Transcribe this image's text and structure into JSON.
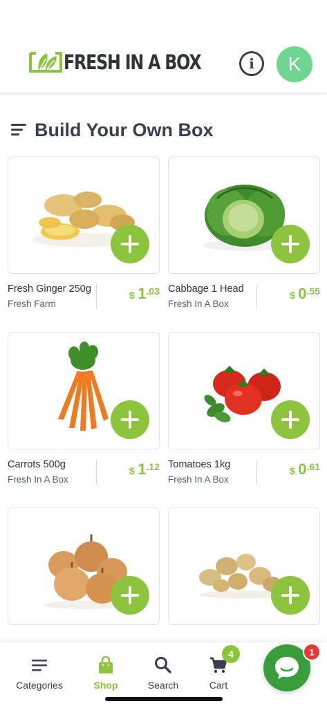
{
  "brand": {
    "name": "FRESH IN A BOX",
    "accent": "#8cc43d"
  },
  "header": {
    "avatar_initial": "K",
    "info_label": "i"
  },
  "page": {
    "title": "Build Your Own Box"
  },
  "products": [
    {
      "name": "Fresh Ginger 250g",
      "vendor": "Fresh Farm",
      "currency": "$",
      "price_whole": "1",
      "price_frac": ".03",
      "image": "ginger"
    },
    {
      "name": "Cabbage 1 Head",
      "vendor": "Fresh In A Box",
      "currency": "$",
      "price_whole": "0",
      "price_frac": ".55",
      "image": "cabbage"
    },
    {
      "name": "Carrots 500g",
      "vendor": "Fresh In A Box",
      "currency": "$",
      "price_whole": "1",
      "price_frac": ".12",
      "image": "carrots"
    },
    {
      "name": "Tomatoes 1kg",
      "vendor": "Fresh In A Box",
      "currency": "$",
      "price_whole": "0",
      "price_frac": ".61",
      "image": "tomatoes"
    },
    {
      "name": "",
      "vendor": "",
      "currency": "",
      "price_whole": "",
      "price_frac": "",
      "image": "onions"
    },
    {
      "name": "",
      "vendor": "",
      "currency": "",
      "price_whole": "",
      "price_frac": "",
      "image": "potatoes"
    }
  ],
  "tabs": [
    {
      "label": "Categories",
      "icon": "menu-icon"
    },
    {
      "label": "Shop",
      "icon": "shopping-bag-icon",
      "active": true
    },
    {
      "label": "Search",
      "icon": "search-icon"
    },
    {
      "label": "Cart",
      "icon": "cart-icon",
      "badge": "4"
    }
  ],
  "chat": {
    "badge": "1",
    "icon": "chat-bubble-icon"
  }
}
